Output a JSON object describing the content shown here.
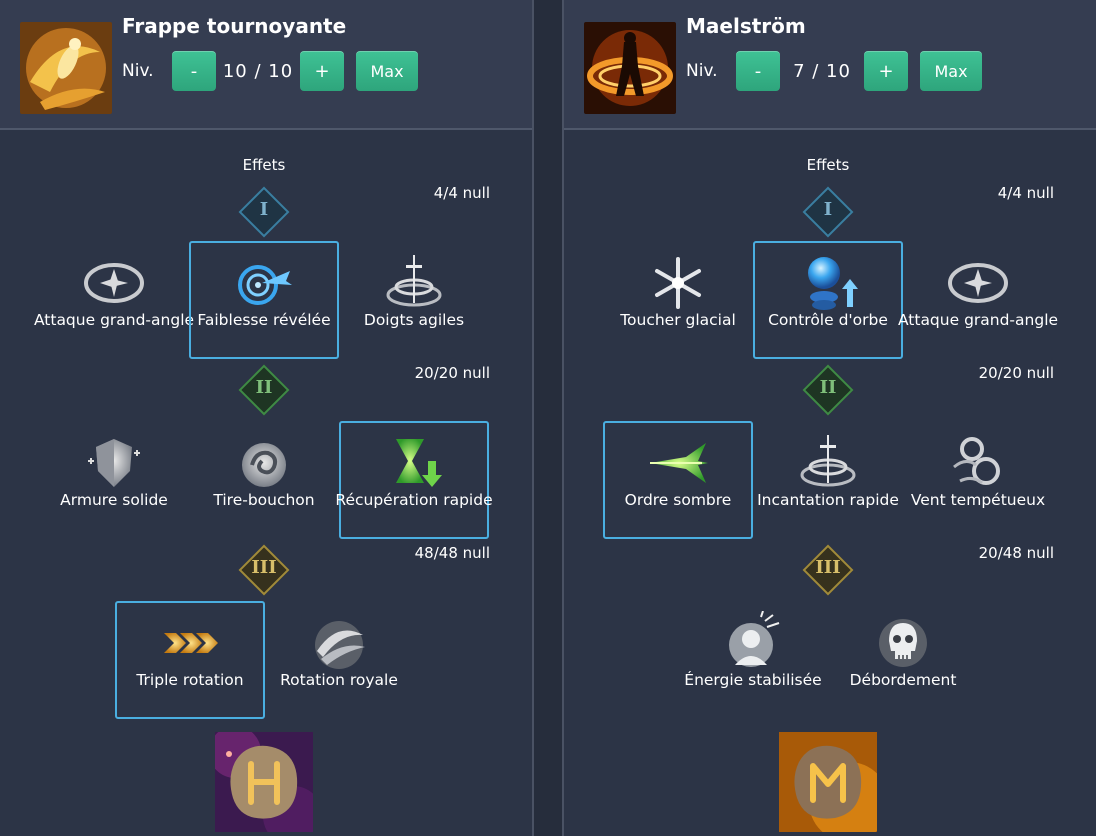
{
  "left": {
    "skill_name": "Frappe tournoyante",
    "niv_label": "Niv.",
    "minus_label": "-",
    "level_value": "10 / 10",
    "plus_label": "+",
    "max_label": "Max",
    "effets_label": "Effets",
    "tier1": {
      "numeral": "I",
      "counter": "4/4 null",
      "nodes": [
        "Attaque grand-angle",
        "Faiblesse révélée",
        "Doigts agiles"
      ]
    },
    "tier2": {
      "numeral": "II",
      "counter": "20/20 null",
      "nodes": [
        "Armure solide",
        "Tire-bouchon",
        "Récupération rapide"
      ]
    },
    "tier3": {
      "numeral": "III",
      "counter": "48/48 null",
      "nodes": [
        "Triple rotation",
        "Rotation royale"
      ]
    }
  },
  "right": {
    "skill_name": "Maelström",
    "niv_label": "Niv.",
    "minus_label": "-",
    "level_value": "7 / 10",
    "plus_label": "+",
    "max_label": "Max",
    "effets_label": "Effets",
    "tier1": {
      "numeral": "I",
      "counter": "4/4 null",
      "nodes": [
        "Toucher glacial",
        "Contrôle d'orbe",
        "Attaque grand-angle"
      ]
    },
    "tier2": {
      "numeral": "II",
      "counter": "20/20 null",
      "nodes": [
        "Ordre sombre",
        "Incantation rapide",
        "Vent tempétueux"
      ]
    },
    "tier3": {
      "numeral": "III",
      "counter": "20/48 null",
      "nodes": [
        "Énergie stabilisée",
        "Débordement"
      ]
    }
  },
  "colors": {
    "background": "#2c3446",
    "header": "#353d51",
    "button_green": "#35b387",
    "selected_border": "#4aaee0",
    "tier1_gem": "#3a7ea0",
    "tier2_gem": "#3f8a45",
    "tier3_gem": "#a08a3a"
  },
  "icons": {
    "left_skill": "whirl-strike-icon",
    "right_skill": "maelstrom-icon",
    "left_rune": "rune-purple-icon",
    "right_rune": "rune-orange-icon"
  }
}
